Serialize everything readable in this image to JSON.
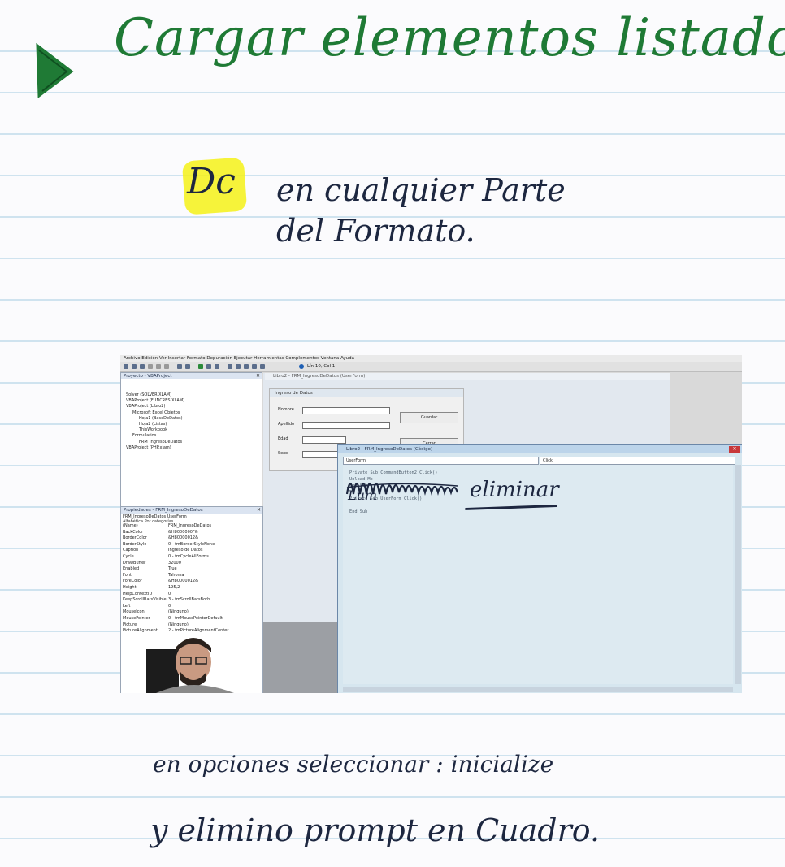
{
  "notes": {
    "title": "Cargar elementos listado",
    "highlight_word": "Dc",
    "line1": "en cualquier Parte",
    "line2": "del Formato.",
    "overwrite_word": "Lum",
    "overlay_word": "eliminar",
    "bottom_line1": "en opciones seleccionar : inicialize",
    "bottom_line2": "y elimino prompt en Cuadro.",
    "colors": {
      "green_ink": "#1f7a35",
      "dark_ink": "#1d2740",
      "highlighter": "#f4f117"
    }
  },
  "screenshot": {
    "menu": "Archivo  Edición  Ver  Insertar  Formato  Depuración  Ejecutar  Herramientas  Complementos  Ventana  Ayuda",
    "toolbar_status": "Lín 10, Col 1",
    "project_pane": {
      "title": "Proyecto - VBAProject",
      "items": [
        "Solver (SOLVER.XLAM)",
        "VBAProject (FUNCRES.XLAM)",
        "VBAProject (Libro2)",
        "Microsoft Excel Objetos",
        "Hoja1 (BaseDeDatos)",
        "Hoja2 (Listas)",
        "ThisWorkbook",
        "Formularios",
        "FRM_IngresoDeDatos",
        "VBAProject (PHP.xlam)"
      ]
    },
    "properties_pane": {
      "title": "Propiedades - FRM_IngresoDeDatos",
      "object": "FRM_IngresoDeDatos UserForm",
      "tabs": "Alfabética  Por categorías",
      "rows": [
        [
          "(Name)",
          "FRM_IngresoDeDatos"
        ],
        [
          "BackColor",
          "&H8000000F&"
        ],
        [
          "BorderColor",
          "&H80000012&"
        ],
        [
          "BorderStyle",
          "0 - fmBorderStyleNone"
        ],
        [
          "Caption",
          "Ingreso de Datos"
        ],
        [
          "Cycle",
          "0 - fmCycleAllForms"
        ],
        [
          "DrawBuffer",
          "32000"
        ],
        [
          "Enabled",
          "True"
        ],
        [
          "Font",
          "Tahoma"
        ],
        [
          "ForeColor",
          "&H80000012&"
        ],
        [
          "Height",
          "195,2"
        ],
        [
          "HelpContextID",
          "0"
        ],
        [
          "KeepScrollBarsVisible",
          "3 - fmScrollBarsBoth"
        ],
        [
          "Left",
          "0"
        ],
        [
          "MouseIcon",
          "(Ninguno)"
        ],
        [
          "MousePointer",
          "0 - fmMousePointerDefault"
        ],
        [
          "Picture",
          "(Ninguno)"
        ],
        [
          "PictureAlignment",
          "2 - fmPictureAlignmentCenter"
        ]
      ]
    },
    "designer": {
      "title": "Libro2 - FRM_IngresoDeDatos (UserForm)",
      "form_caption": "Ingreso de Datos",
      "labels": [
        "Nombre",
        "Apellido",
        "Edad",
        "Sexo"
      ],
      "save_button": "Guardar",
      "close_button": "Cerrar"
    },
    "code_window": {
      "title": "Libro2 - FRM_IngresoDeDatos (Código)",
      "object_combo": "UserForm",
      "procedure_combo": "Click",
      "lines": [
        "Private Sub CommandButton2_Click()",
        "    Unload Me",
        "End Sub",
        "",
        "Private Sub UserForm_Click()",
        "",
        "End Sub"
      ]
    }
  }
}
